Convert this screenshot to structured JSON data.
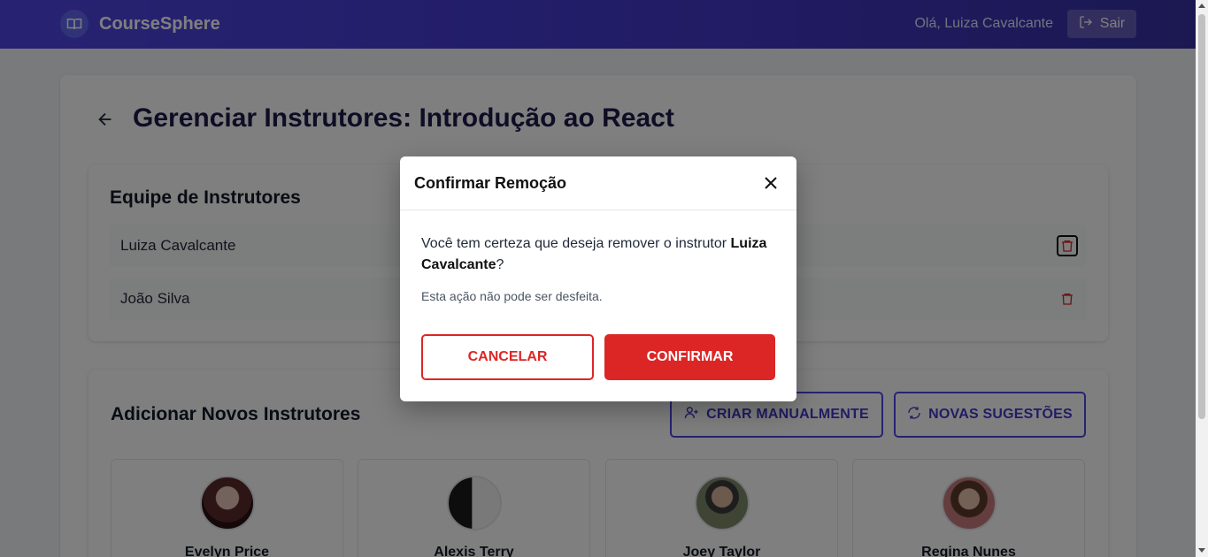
{
  "header": {
    "brand": "CourseSphere",
    "greeting": "Olá, Luiza Cavalcante",
    "logout_label": "Sair"
  },
  "page": {
    "title": "Gerenciar Instrutores: Introdução ao React"
  },
  "team": {
    "title": "Equipe de Instrutores",
    "members": [
      {
        "name": "Luiza Cavalcante"
      },
      {
        "name": "João Silva"
      }
    ]
  },
  "add": {
    "title": "Adicionar Novos Instrutores",
    "create_label": "CRIAR MANUALMENTE",
    "suggest_label": "NOVAS SUGESTÕES",
    "suggestions": [
      {
        "name": "Evelyn Price"
      },
      {
        "name": "Alexis Terry"
      },
      {
        "name": "Joey Taylor"
      },
      {
        "name": "Regina Nunes"
      }
    ]
  },
  "modal": {
    "title": "Confirmar Remoção",
    "message_prefix": "Você tem certeza que deseja remover o instrutor",
    "message_name": "Luiza Cavalcante",
    "message_suffix": "?",
    "note": "Esta ação não pode ser desfeita.",
    "cancel_label": "CANCELAR",
    "confirm_label": "CONFIRMAR"
  },
  "colors": {
    "brand": "#4f46e5",
    "danger": "#dc2626"
  }
}
